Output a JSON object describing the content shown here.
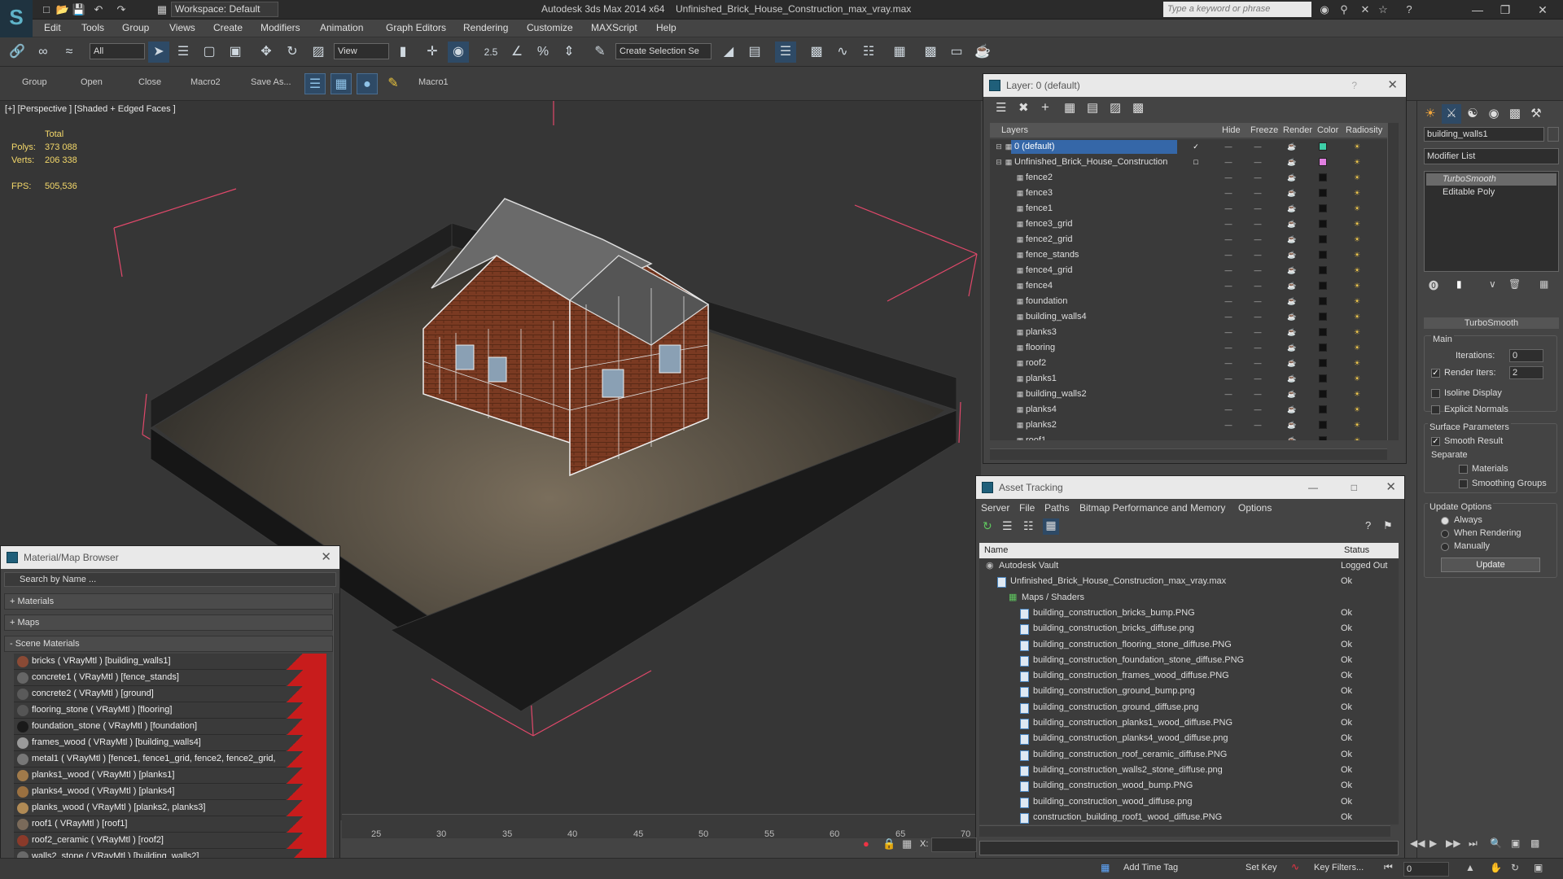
{
  "titlebar": {
    "workspace": "Workspace: Default",
    "app": "Autodesk 3ds Max  2014 x64",
    "file": "Unfinished_Brick_House_Construction_max_vray.max",
    "search_placeholder": "Type a keyword or phrase"
  },
  "menu": [
    "Edit",
    "Tools",
    "Group",
    "Views",
    "Create",
    "Modifiers",
    "Animation",
    "Graph Editors",
    "Rendering",
    "Customize",
    "MAXScript",
    "Help"
  ],
  "toolbar": {
    "filter": "All",
    "refcoord": "View",
    "selset": "Create Selection Se",
    "snap": "2.5"
  },
  "toolbar2": {
    "items": [
      "Group",
      "Open",
      "Close",
      "Macro2",
      "Save As...",
      "Macro1"
    ]
  },
  "viewport": {
    "label": "[+] [Perspective ] [Shaded + Edged Faces ]",
    "stats": {
      "total": "Total",
      "polys_label": "Polys:",
      "polys": "373 088",
      "verts_label": "Verts:",
      "verts": "206 338",
      "fps_label": "FPS:",
      "fps": "505,536"
    }
  },
  "timeline": {
    "ticks": [
      "25",
      "30",
      "35",
      "40",
      "45",
      "50",
      "55",
      "60",
      "65",
      "70"
    ]
  },
  "layer_panel": {
    "title": "Layer: 0 (default)",
    "headers": {
      "layers": "Layers",
      "hide": "Hide",
      "freeze": "Freeze",
      "render": "Render",
      "color": "Color",
      "radiosity": "Radiosity"
    },
    "rows": [
      {
        "name": "0 (default)",
        "color": "#3ecfa8",
        "sel": true
      },
      {
        "name": "Unfinished_Brick_House_Construction",
        "color": "#e07fe0"
      },
      {
        "name": "fence2",
        "color": "#111111"
      },
      {
        "name": "fence3",
        "color": "#111111"
      },
      {
        "name": "fence1",
        "color": "#111111"
      },
      {
        "name": "fence3_grid",
        "color": "#111111"
      },
      {
        "name": "fence2_grid",
        "color": "#111111"
      },
      {
        "name": "fence_stands",
        "color": "#111111"
      },
      {
        "name": "fence4_grid",
        "color": "#111111"
      },
      {
        "name": "fence4",
        "color": "#111111"
      },
      {
        "name": "foundation",
        "color": "#111111"
      },
      {
        "name": "building_walls4",
        "color": "#111111"
      },
      {
        "name": "planks3",
        "color": "#111111"
      },
      {
        "name": "flooring",
        "color": "#111111"
      },
      {
        "name": "roof2",
        "color": "#111111"
      },
      {
        "name": "planks1",
        "color": "#111111"
      },
      {
        "name": "building_walls2",
        "color": "#111111"
      },
      {
        "name": "planks4",
        "color": "#111111"
      },
      {
        "name": "planks2",
        "color": "#111111"
      },
      {
        "name": "roof1",
        "color": "#111111"
      }
    ]
  },
  "asset_panel": {
    "title": "Asset Tracking",
    "menu": [
      "Server",
      "File",
      "Paths",
      "Bitmap Performance and Memory",
      "Options"
    ],
    "headers": {
      "name": "Name",
      "status": "Status"
    },
    "rows": [
      {
        "name": "Autodesk Vault",
        "status": "Logged Out",
        "indent": 0
      },
      {
        "name": "Unfinished_Brick_House_Construction_max_vray.max",
        "status": "Ok",
        "indent": 1
      },
      {
        "name": "Maps / Shaders",
        "status": "",
        "indent": 2
      },
      {
        "name": "building_construction_bricks_bump.PNG",
        "status": "Ok",
        "indent": 3
      },
      {
        "name": "building_construction_bricks_diffuse.png",
        "status": "Ok",
        "indent": 3
      },
      {
        "name": "building_construction_flooring_stone_diffuse.PNG",
        "status": "Ok",
        "indent": 3
      },
      {
        "name": "building_construction_foundation_stone_diffuse.PNG",
        "status": "Ok",
        "indent": 3
      },
      {
        "name": "building_construction_frames_wood_diffuse.PNG",
        "status": "Ok",
        "indent": 3
      },
      {
        "name": "building_construction_ground_bump.png",
        "status": "Ok",
        "indent": 3
      },
      {
        "name": "building_construction_ground_diffuse.png",
        "status": "Ok",
        "indent": 3
      },
      {
        "name": "building_construction_planks1_wood_diffuse.PNG",
        "status": "Ok",
        "indent": 3
      },
      {
        "name": "building_construction_planks4_wood_diffuse.png",
        "status": "Ok",
        "indent": 3
      },
      {
        "name": "building_construction_roof_ceramic_diffuse.PNG",
        "status": "Ok",
        "indent": 3
      },
      {
        "name": "building_construction_walls2_stone_diffuse.png",
        "status": "Ok",
        "indent": 3
      },
      {
        "name": "building_construction_wood_bump.PNG",
        "status": "Ok",
        "indent": 3
      },
      {
        "name": "building_construction_wood_diffuse.png",
        "status": "Ok",
        "indent": 3
      },
      {
        "name": "construction_building_roof1_wood_diffuse.PNG",
        "status": "Ok",
        "indent": 3
      }
    ]
  },
  "mat_panel": {
    "title": "Material/Map Browser",
    "search_placeholder": "Search by Name ...",
    "sections": {
      "materials": "+ Materials",
      "maps": "+ Maps",
      "scene": "- Scene Materials"
    },
    "rows": [
      {
        "name": "bricks  ( VRayMtl ) [building_walls1]",
        "ball": "#8a4a35"
      },
      {
        "name": "concrete1  ( VRayMtl ) [fence_stands]",
        "ball": "#666666"
      },
      {
        "name": "concrete2  ( VRayMtl ) [ground]",
        "ball": "#5a5a5a"
      },
      {
        "name": "flooring_stone  ( VRayMtl ) [flooring]",
        "ball": "#555555"
      },
      {
        "name": "foundation_stone  ( VRayMtl ) [foundation]",
        "ball": "#1a1a1a"
      },
      {
        "name": "frames_wood  ( VRayMtl ) [building_walls4]",
        "ball": "#9a9a9a"
      },
      {
        "name": "metal1  ( VRayMtl ) [fence1, fence1_grid, fence2, fence2_grid, fence...",
        "ball": "#777777"
      },
      {
        "name": "planks1_wood  ( VRayMtl ) [planks1]",
        "ball": "#a07a4a"
      },
      {
        "name": "planks4_wood  ( VRayMtl ) [planks4]",
        "ball": "#9a7040"
      },
      {
        "name": "planks_wood  ( VRayMtl ) [planks2, planks3]",
        "ball": "#b08a55"
      },
      {
        "name": "roof1  ( VRayMtl ) [roof1]",
        "ball": "#7a6a5a"
      },
      {
        "name": "roof2_ceramic  ( VRayMtl ) [roof2]",
        "ball": "#8a3a2a"
      },
      {
        "name": "walls2_stone  ( VRayMtl ) [building_walls2]",
        "ball": "#6a6a6a"
      }
    ]
  },
  "cmd_panel": {
    "object_name": "building_walls1",
    "modifier_list": "Modifier List",
    "stack": [
      "TurboSmooth",
      "Editable Poly"
    ],
    "rollout": "TurboSmooth",
    "main": "Main",
    "iterations_label": "Iterations:",
    "iterations": "0",
    "render_iters_label": "Render Iters:",
    "render_iters": "2",
    "isoline": "Isoline Display",
    "explicit": "Explicit Normals",
    "surface": "Surface Parameters",
    "smooth": "Smooth Result",
    "separate": "Separate",
    "materials": "Materials",
    "smoothing": "Smoothing Groups",
    "update_opts": "Update Options",
    "always": "Always",
    "when_rendering": "When Rendering",
    "manually": "Manually",
    "update_btn": "Update"
  },
  "statusbar": {
    "add_time_tag": "Add Time Tag",
    "set_key": "Set Key",
    "key_filters": "Key Filters...",
    "frame": "0",
    "x_label": "X:"
  }
}
